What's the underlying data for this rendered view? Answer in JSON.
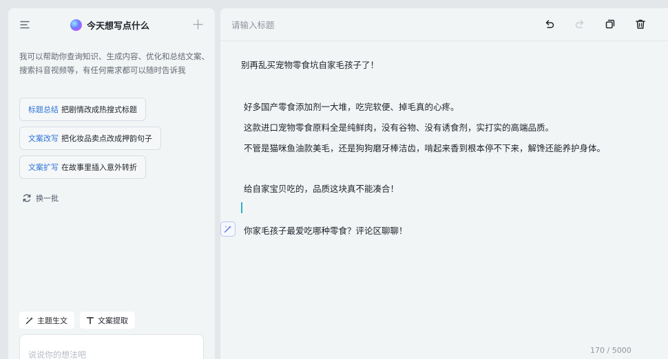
{
  "left_panel": {
    "title": "今天想写点什么",
    "intro": "我可以帮助你查询知识、生成内容、优化和总结文案、搜索抖音视频等，有任何需求都可以随时告诉我",
    "suggestions": [
      {
        "tag": "标题总结",
        "desc": "把剧情改成热搜式标题"
      },
      {
        "tag": "文案改写",
        "desc": "把化妆品卖点改成押韵句子"
      },
      {
        "tag": "文案扩写",
        "desc": "在故事里插入意外转折"
      }
    ],
    "refresh_label": "换一批",
    "tools": {
      "topic_label": "主题生文",
      "extract_label": "文案提取"
    },
    "input_placeholder": "说说你的想法吧"
  },
  "editor": {
    "title_placeholder": "请输入标题",
    "lines": [
      "别再乱买宠物零食坑自家毛孩子了！",
      "好多国产零食添加剂一大堆，吃完软便、掉毛真的心疼。",
      "这款进口宠物零食原料全是纯鲜肉，没有谷物、没有诱食剂，实打实的高端品质。",
      "不管是猫咪鱼油款美毛，还是狗狗磨牙棒洁齿，啃起来香到根本停不下来，解馋还能养护身体。",
      "给自家宝贝吃的，品质这块真不能凑合！",
      "你家毛孩子最爱吃哪种零食？评论区聊聊！"
    ],
    "char_count": "170 / 5000"
  },
  "colors": {
    "accent_tag": "#2b74d8",
    "caret": "#2bb0c8"
  }
}
